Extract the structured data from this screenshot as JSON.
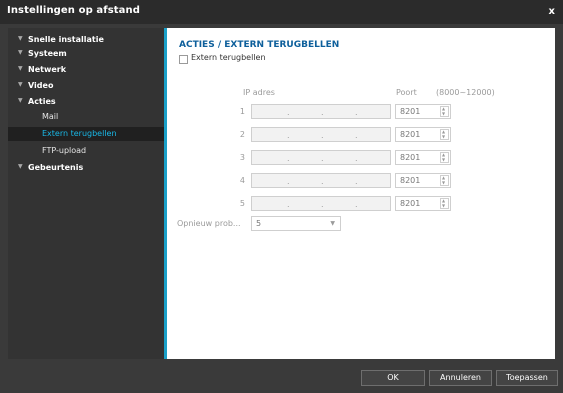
{
  "window": {
    "title": "Instellingen op afstand",
    "close_label": "x"
  },
  "sidebar": {
    "items": [
      {
        "label": "Snelle installatie"
      },
      {
        "label": "Systeem"
      },
      {
        "label": "Netwerk"
      },
      {
        "label": "Video"
      },
      {
        "label": "Acties",
        "children": [
          {
            "label": "Mail"
          },
          {
            "label": "Extern terugbellen",
            "active": true
          },
          {
            "label": "FTP-upload"
          }
        ]
      },
      {
        "label": "Gebeurtenis"
      }
    ],
    "expand_icon": "triangle-down-icon"
  },
  "content": {
    "title": "ACTIES / EXTERN TERUGBELLEN",
    "enable_checkbox": {
      "label": "Extern terugbellen",
      "checked": false
    },
    "ip_header": "IP adres",
    "port_header": "Poort",
    "port_range": "(8000~12000)",
    "rows": [
      {
        "num": "1",
        "ip": ".  .  .",
        "port": "8201"
      },
      {
        "num": "2",
        "ip": ".  .  .",
        "port": "8201"
      },
      {
        "num": "3",
        "ip": ".  .  .",
        "port": "8201"
      },
      {
        "num": "4",
        "ip": ".  .  .",
        "port": "8201"
      },
      {
        "num": "5",
        "ip": ".  .  .",
        "port": "8201"
      }
    ],
    "retry_label": "Opnieuw prob...",
    "retry_value": "5"
  },
  "footer": {
    "ok": "OK",
    "cancel": "Annuleren",
    "apply": "Toepassen"
  },
  "colors": {
    "accent": "#1aa0c8",
    "title_text": "#0d5f9b",
    "active_nav": "#19b7e6"
  }
}
